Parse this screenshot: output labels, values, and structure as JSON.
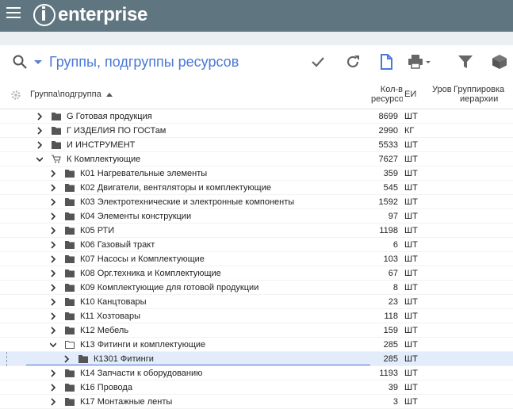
{
  "app": {
    "logo_text": "enterprise"
  },
  "toolbar": {
    "title": "Группы, подгруппы ресурсов"
  },
  "columns": {
    "group": "Группа\\подгруппа",
    "qty_line1": "Кол-в",
    "qty_line2": "ресурсов",
    "unit": "ЕИ",
    "level": "Уров",
    "grouping_line1": "Группировка",
    "grouping_line2": "иерархии"
  },
  "rows": [
    {
      "name": "G Готовая продукция",
      "qty": "8699",
      "unit": "ШТ",
      "level": 0,
      "state": "collapsed",
      "icon": "folder"
    },
    {
      "name": "Г ИЗДЕЛИЯ ПО ГОСТам",
      "qty": "2990",
      "unit": "КГ",
      "level": 0,
      "state": "collapsed",
      "icon": "folder"
    },
    {
      "name": "И ИНСТРУМЕНТ",
      "qty": "5533",
      "unit": "ШТ",
      "level": 0,
      "state": "collapsed",
      "icon": "folder"
    },
    {
      "name": "К Комплектующие",
      "qty": "7627",
      "unit": "ШТ",
      "level": 0,
      "state": "expanded",
      "icon": "cart"
    },
    {
      "name": "К01 Нагревательные элементы",
      "qty": "359",
      "unit": "ШТ",
      "level": 1,
      "state": "collapsed",
      "icon": "folder"
    },
    {
      "name": "К02 Двигатели, вентяляторы и комплектующие",
      "qty": "545",
      "unit": "ШТ",
      "level": 1,
      "state": "collapsed",
      "icon": "folder"
    },
    {
      "name": "К03 Электротехнические и электронные компоненты",
      "qty": "1592",
      "unit": "ШТ",
      "level": 1,
      "state": "collapsed",
      "icon": "folder"
    },
    {
      "name": "К04 Элементы конструкции",
      "qty": "97",
      "unit": "ШТ",
      "level": 1,
      "state": "collapsed",
      "icon": "folder"
    },
    {
      "name": "К05 РТИ",
      "qty": "1198",
      "unit": "ШТ",
      "level": 1,
      "state": "collapsed",
      "icon": "folder"
    },
    {
      "name": "К06 Газовый тракт",
      "qty": "6",
      "unit": "ШТ",
      "level": 1,
      "state": "collapsed",
      "icon": "folder"
    },
    {
      "name": "К07 Насосы и Комплектующие",
      "qty": "103",
      "unit": "ШТ",
      "level": 1,
      "state": "collapsed",
      "icon": "folder"
    },
    {
      "name": "К08 Орг.техника и Комплектующие",
      "qty": "67",
      "unit": "ШТ",
      "level": 1,
      "state": "collapsed",
      "icon": "folder"
    },
    {
      "name": "К09 Комплектующие для готовой продукции",
      "qty": "8",
      "unit": "ШТ",
      "level": 1,
      "state": "collapsed",
      "icon": "folder"
    },
    {
      "name": "К10 Канцтовары",
      "qty": "23",
      "unit": "ШТ",
      "level": 1,
      "state": "collapsed",
      "icon": "folder"
    },
    {
      "name": "К11 Хозтовары",
      "qty": "118",
      "unit": "ШТ",
      "level": 1,
      "state": "collapsed",
      "icon": "folder"
    },
    {
      "name": "К12 Мебель",
      "qty": "159",
      "unit": "ШТ",
      "level": 1,
      "state": "collapsed",
      "icon": "folder"
    },
    {
      "name": "К13 Фитинги и комплектующие",
      "qty": "285",
      "unit": "ШТ",
      "level": 1,
      "state": "expanded",
      "icon": "folder-open"
    },
    {
      "name": "К1301 Фитинги",
      "qty": "285",
      "unit": "ШТ",
      "level": 2,
      "state": "collapsed",
      "icon": "folder",
      "selected": true
    },
    {
      "name": "К14 Запчасти к оборудованию",
      "qty": "1193",
      "unit": "ШТ",
      "level": 1,
      "state": "collapsed",
      "icon": "folder"
    },
    {
      "name": "К16 Провода",
      "qty": "39",
      "unit": "ШТ",
      "level": 1,
      "state": "collapsed",
      "icon": "folder"
    },
    {
      "name": "К17 Монтажные ленты",
      "qty": "3",
      "unit": "ШТ",
      "level": 1,
      "state": "collapsed",
      "icon": "folder"
    }
  ]
}
